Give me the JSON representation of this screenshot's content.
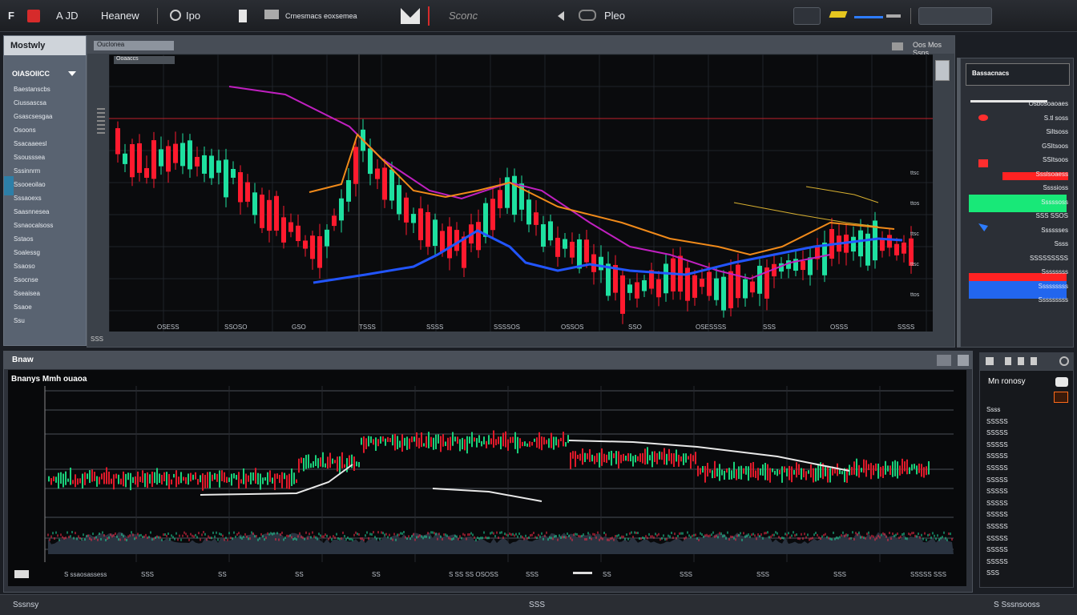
{
  "toolbar": {
    "item1": "F",
    "item2": "A JD",
    "item3": "Heanew",
    "item4": "Ipo",
    "item5": "Crnesmacs eoxsemea",
    "item6": "Sconc",
    "item7": "Pleo",
    "accent_red": "#d62b2b",
    "accent_blue": "#2d7cff"
  },
  "left_panel": {
    "title": "Mostwly",
    "section": "OIASOIICC",
    "items": [
      "Baestanscbs",
      "Ciussascsa",
      "Gsascsesgaa",
      "Osoons",
      "Ssacaaeesl",
      "Ssousssea",
      "Sssinnrm",
      "Ssooeoilao",
      "Sssaoexs",
      "Saasnnesea",
      "Ssnaocalsoss",
      "Sstaos",
      "Soalessg",
      "Ssaoso",
      "Ssocnse",
      "Sseaisea",
      "Ssaoe",
      "Ssu"
    ]
  },
  "main_chart": {
    "header_tag": "Ouclonea",
    "status_right": "Oos Mos Ssns",
    "title_tag": "Ooaaccs",
    "bottom_label": "SSS",
    "price_labels": [
      "ttsc",
      "ttos",
      "ttsc",
      "ttsc",
      "ttos"
    ],
    "time_labels": [
      "OSESS",
      "SSOSO",
      "GSO",
      "TSSS",
      "SSSS",
      "SSSSOS",
      "OSSOS",
      "SSO",
      "OSESSSS",
      "SSS",
      "OSSS",
      "SSSS"
    ],
    "up_color": "#1ee0a0",
    "down_color": "#ff1a2e"
  },
  "right_panel": {
    "title": "Bassacnacs",
    "rows": [
      "Osbosoaoaes",
      "S.tl soss",
      "Siltsoss",
      "GSItsoos",
      "SSItsoos",
      "Ssslsoaess",
      "Ssssioss",
      "Sssssoss",
      "SSS SSOS",
      "Sssssses",
      "Ssss",
      "SSSSSSSSS",
      "Ssssssss",
      "Sssssssss",
      "Sssssssss"
    ],
    "green_bar": "#18e878",
    "red_bar": "#ff2222",
    "blue_bar": "#2266ee"
  },
  "lower_chart": {
    "window_title": "Bnaw",
    "title": "Bnanys Mmh ouaoa",
    "bottom_labels": [
      "S ssaosassess",
      "SSS",
      "SS",
      "SS",
      "SS",
      "S SS SS OSOSS",
      "SSS",
      "SS",
      "SSS",
      "SSS",
      "SSS",
      "SSSSS SSS"
    ]
  },
  "orderbook": {
    "title": "Mn ronosy",
    "rows": [
      "Ssss",
      "SSSSS",
      "SSSSS",
      "SSSSS",
      "SSSSS",
      "SSSSS",
      "SSSSS",
      "SSSSS",
      "SSSSS",
      "SSSSS",
      "SSSSS",
      "SSSSS",
      "SSSSS",
      "SSSSS",
      "SSS"
    ]
  },
  "status_bar": {
    "left": "Sssnsy",
    "center": "SSS",
    "right": "S Sssnsooss"
  }
}
